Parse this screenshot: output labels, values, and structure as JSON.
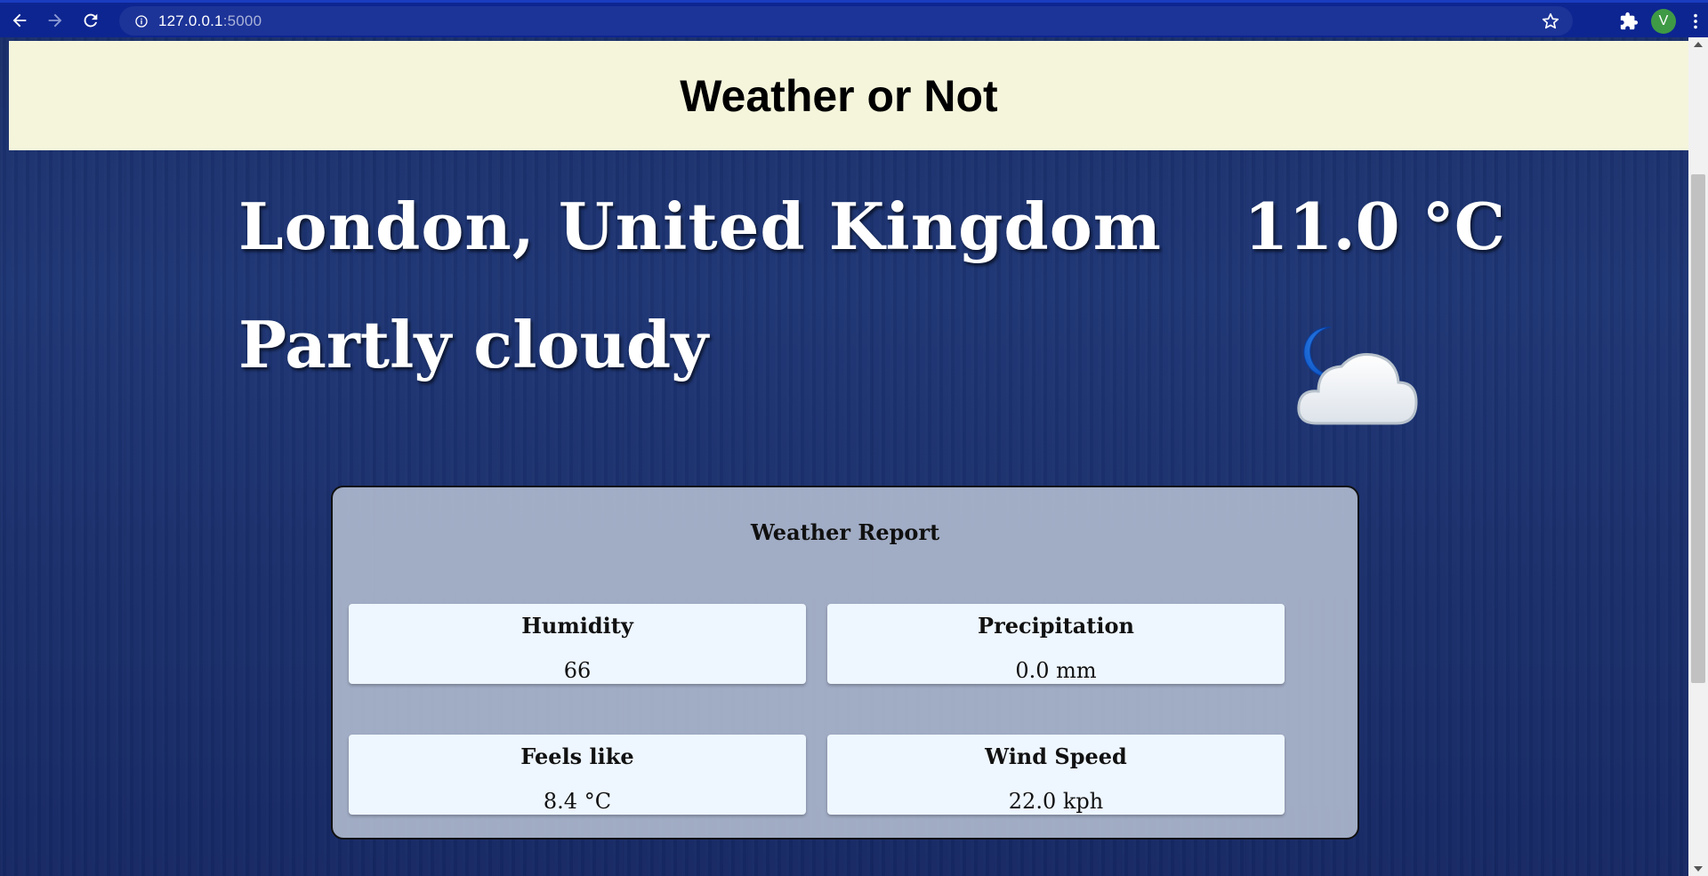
{
  "browser": {
    "url_host": "127.0.0.1",
    "url_port": ":5000",
    "avatar_letter": "V"
  },
  "header": {
    "title": "Weather or Not"
  },
  "current": {
    "location": "London, United Kingdom",
    "temperature": "11.0 °C",
    "condition": "Partly cloudy",
    "icon": "moon-cloud-icon"
  },
  "report": {
    "title": "Weather Report",
    "cards": [
      {
        "label": "Humidity",
        "value": "66"
      },
      {
        "label": "Precipitation",
        "value": "0.0 mm"
      },
      {
        "label": "Feels like",
        "value": "8.4 °C"
      },
      {
        "label": "Wind Speed",
        "value": "22.0 kph"
      }
    ]
  },
  "colors": {
    "header_bg": "#f5f5dc",
    "browser_bar": "#0d2590",
    "page_bg": "#1a2f6b",
    "card_bg": "#eef6ff"
  }
}
